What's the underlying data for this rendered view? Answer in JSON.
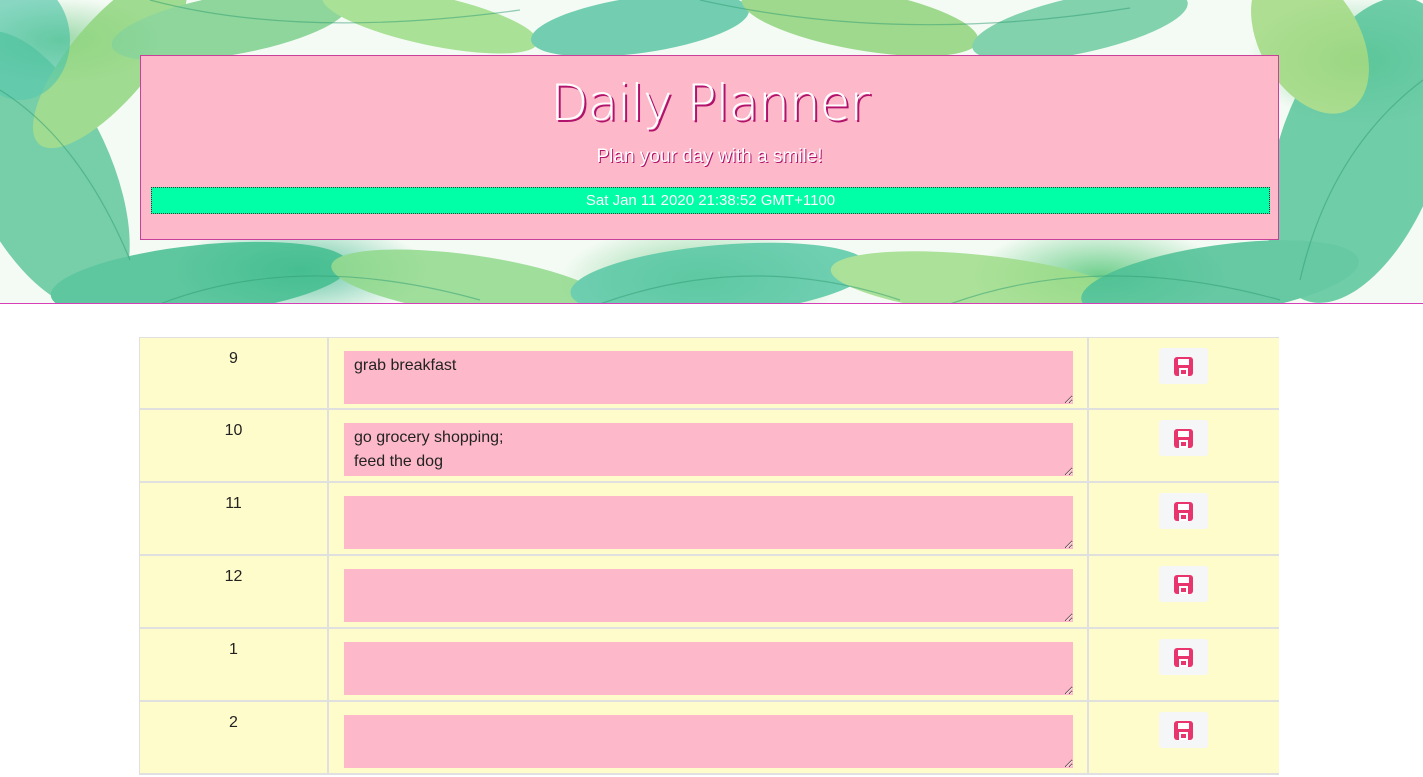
{
  "header": {
    "title": "Daily Planner",
    "subtitle": "Plan your day with a smile!",
    "current_datetime": "Sat Jan 11 2020 21:38:52 GMT+1100"
  },
  "rows": [
    {
      "hour": "9",
      "text": "grab breakfast"
    },
    {
      "hour": "10",
      "text": "go grocery shopping;\nfeed the dog"
    },
    {
      "hour": "11",
      "text": ""
    },
    {
      "hour": "12",
      "text": ""
    },
    {
      "hour": "1",
      "text": ""
    },
    {
      "hour": "2",
      "text": ""
    }
  ],
  "save_icon": "floppy-disk-icon",
  "colors": {
    "jumbotron": "#fdb9c9",
    "datetime_bar": "#00ffa6",
    "row_background": "#fffccc",
    "textarea": "#fdb9c9",
    "save_icon": "#e8356d"
  }
}
